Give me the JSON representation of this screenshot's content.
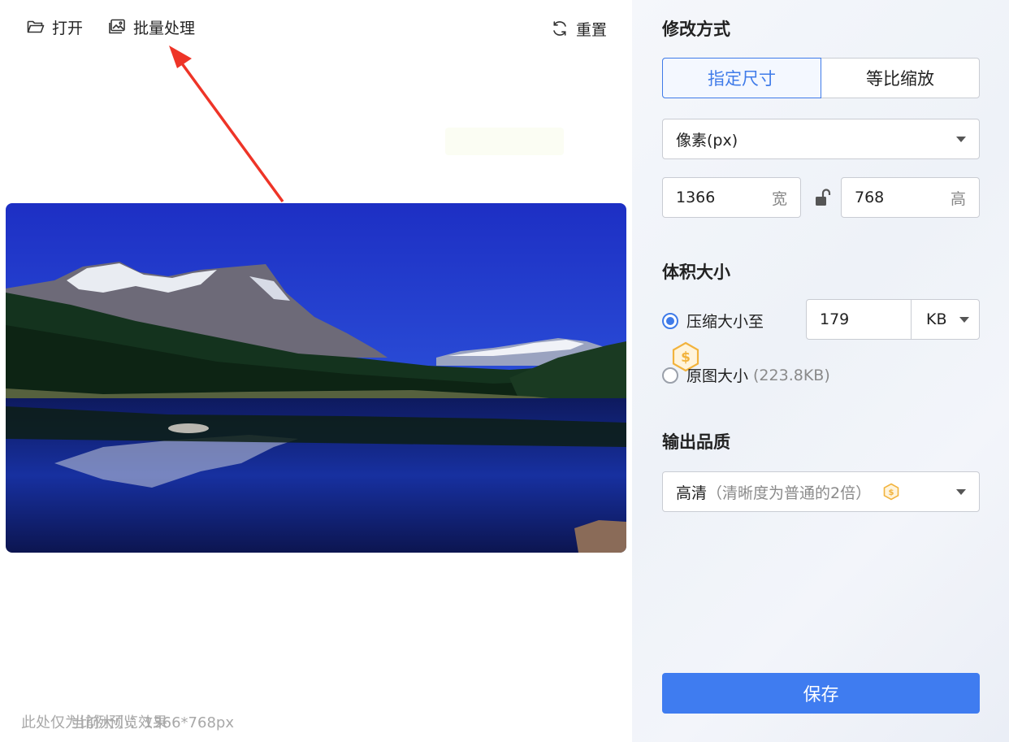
{
  "toolbar": {
    "open_label": "打开",
    "batch_label": "批量处理",
    "reset_label": "重置"
  },
  "preview": {
    "hint_left": "此处仅为比例预览效果",
    "current_size": "当前大小：1366*768px"
  },
  "panel": {
    "mode_title": "修改方式",
    "mode_tabs": [
      "指定尺寸",
      "等比缩放"
    ],
    "active_mode": "指定尺寸",
    "unit_select": "像素(px)",
    "width_value": "1366",
    "width_unit": "宽",
    "height_value": "768",
    "height_unit": "高",
    "volume_title": "体积大小",
    "compress_label": "压缩大小至",
    "compress_value": "179",
    "compress_unit": "KB",
    "original_label": "原图大小",
    "original_size": "(223.8KB)",
    "quality_title": "输出品质",
    "quality_value": "高清",
    "quality_desc": "（清晰度为普通的2倍）",
    "save_label": "保存"
  },
  "colors": {
    "accent": "#3f7be9",
    "save_button": "#3f7cf0",
    "vip_badge": "#f2b33d",
    "annotation_arrow": "#ee3427"
  },
  "icons": [
    "folder-open-icon",
    "image-gallery-icon",
    "refresh-icon",
    "unlock-icon",
    "vip-coin-icon",
    "caret-down-icon"
  ]
}
